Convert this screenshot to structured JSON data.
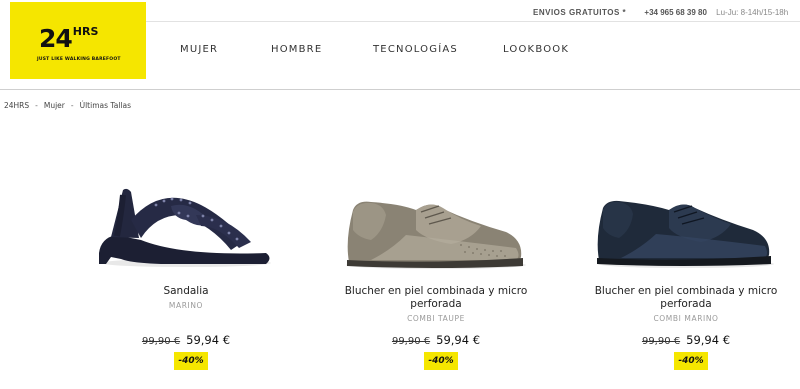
{
  "brand": {
    "name": "24",
    "superscript": "HRS",
    "tagline": "JUST LIKE WALKING BAREFOOT",
    "color": "#f5e600"
  },
  "topbar": {
    "shipping": "ENVIOS GRATUITOS *",
    "phone": "+34 965 68 39 80",
    "hours": "Lu-Ju: 8-14h/15-18h"
  },
  "nav": [
    {
      "label": "MUJER"
    },
    {
      "label": "HOMBRE"
    },
    {
      "label": "TECNOLOGÍAS"
    },
    {
      "label": "LOOKBOOK"
    }
  ],
  "breadcrumb": [
    "24HRS",
    "Mujer",
    "Últimas Tallas"
  ],
  "products": [
    {
      "name": "Sandalia",
      "name2": "",
      "color": "MARINO",
      "old_price": "99,90 €",
      "new_price": "59,94 €",
      "discount": "-40%",
      "image": "navy-sandal"
    },
    {
      "name": "Blucher en piel combinada y micro",
      "name2": "perforada",
      "color": "COMBI TAUPE",
      "old_price": "99,90 €",
      "new_price": "59,94 €",
      "discount": "-40%",
      "image": "taupe-blucher"
    },
    {
      "name": "Blucher en piel combinada y micro",
      "name2": "perforada",
      "color": "COMBI MARINO",
      "old_price": "99,90 €",
      "new_price": "59,94 €",
      "discount": "-40%",
      "image": "navy-blucher"
    }
  ]
}
